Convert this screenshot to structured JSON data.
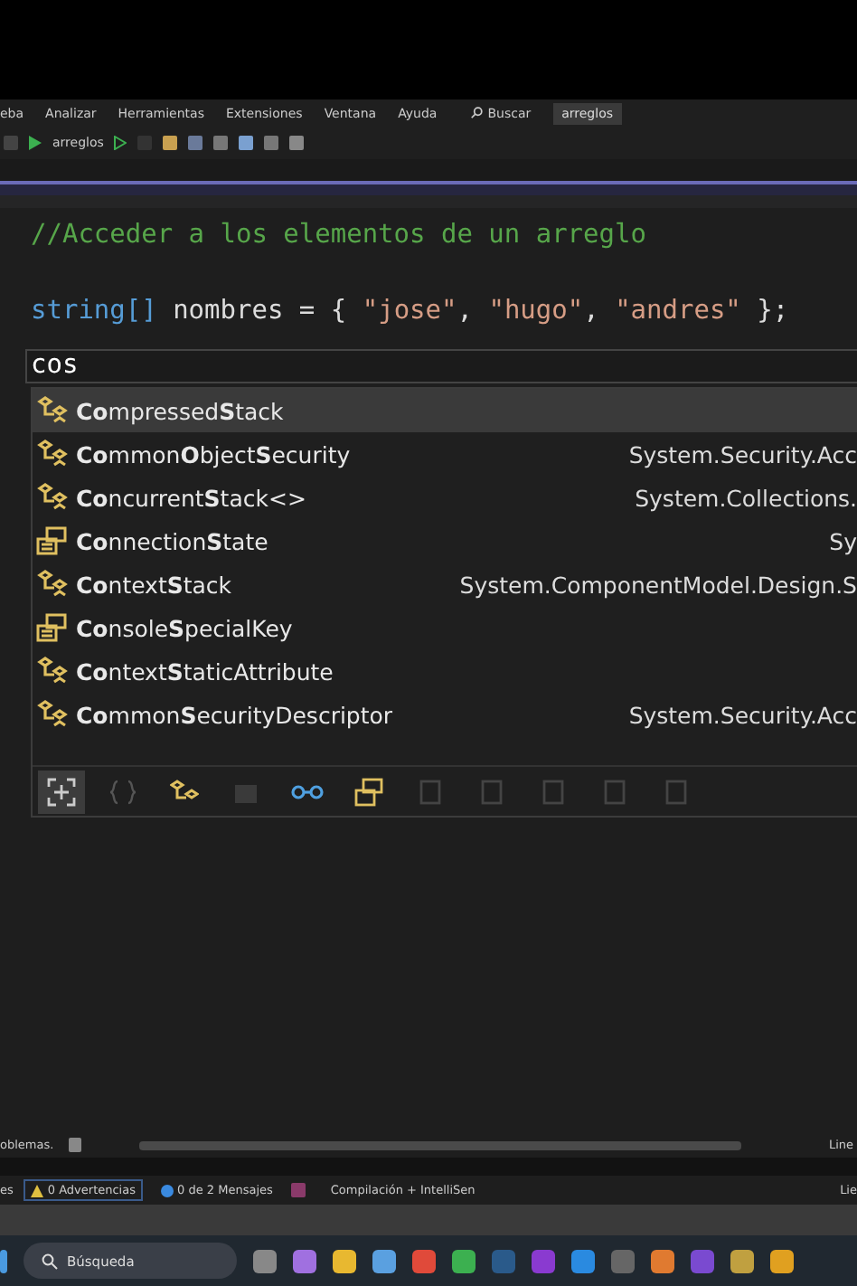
{
  "menu_bar": {
    "items": [
      "eba",
      "Analizar",
      "Herramientas",
      "Extensiones",
      "Ventana",
      "Ayuda"
    ],
    "search": "Buscar",
    "solution": "arreglos"
  },
  "toolbar": {
    "run_target": "arreglos"
  },
  "editor": {
    "lines": [
      {
        "kind": "comment",
        "text": "//Acceder a los elementos de un arreglo"
      },
      {
        "kind": "blank"
      },
      {
        "kind": "code",
        "tokens": [
          {
            "kind": "type",
            "text": "string[]"
          },
          {
            "kind": "ident",
            "text": "nombres"
          },
          {
            "kind": "op",
            "text": "="
          },
          {
            "kind": "op",
            "text": "{"
          },
          {
            "kind": "string",
            "text": "\"jose\""
          },
          {
            "kind": "comma",
            "text": ","
          },
          {
            "kind": "string",
            "text": "\"hugo\""
          },
          {
            "kind": "comma",
            "text": ","
          },
          {
            "kind": "string",
            "text": "\"andres\""
          },
          {
            "kind": "op",
            "text": "};"
          }
        ]
      }
    ],
    "input": "cos"
  },
  "completion": {
    "items": [
      {
        "kind": "class",
        "label": "**Co**mpressed**S**tack",
        "selected": true
      },
      {
        "kind": "class",
        "label": "**Co**mmon**O**bject**S**ecurity",
        "namespace": "System.Security.Acc",
        "selected": false
      },
      {
        "kind": "class",
        "label": "**Co**ncurrent**S**tack<>",
        "namespace": "System.Collections.",
        "selected": false
      },
      {
        "kind": "enum",
        "label": "**Co**nnection**S**tate",
        "namespace": "Sy",
        "selected": false
      },
      {
        "kind": "class",
        "label": "**Co**ntext**S**tack",
        "namespace": "System.ComponentModel.Design.S",
        "selected": false
      },
      {
        "kind": "enum",
        "label": "**Co**nsole**S**pecialKey",
        "selected": false
      },
      {
        "kind": "class",
        "label": "**Co**ntext**S**taticAttribute",
        "selected": false
      },
      {
        "kind": "class",
        "label": "**Co**mmon**S**ecurityDescriptor",
        "namespace": "System.Security.Acc",
        "selected": false
      }
    ],
    "filters": [
      {
        "kind": "snippet",
        "selected": true
      },
      {
        "kind": "namespace",
        "selected": false
      },
      {
        "kind": "class",
        "selected": false
      },
      {
        "kind": "struct",
        "selected": false
      },
      {
        "kind": "interface",
        "selected": false
      },
      {
        "kind": "enum",
        "selected": false
      },
      {
        "kind": "delegate",
        "selected": false
      },
      {
        "kind": "module",
        "selected": false
      },
      {
        "kind": "generic",
        "selected": false
      },
      {
        "kind": "list",
        "selected": false
      },
      {
        "kind": "doc",
        "selected": false
      }
    ]
  },
  "editor_status": {
    "problems": "oblemas.",
    "position": "Line"
  },
  "error_list": {
    "first": "es",
    "warnings": "0 Advertencias",
    "messages": "0 de 2 Mensajes",
    "scope": "Compilación + IntelliSen",
    "right": "Lie"
  },
  "taskbar": {
    "search": "Búsqueda"
  }
}
